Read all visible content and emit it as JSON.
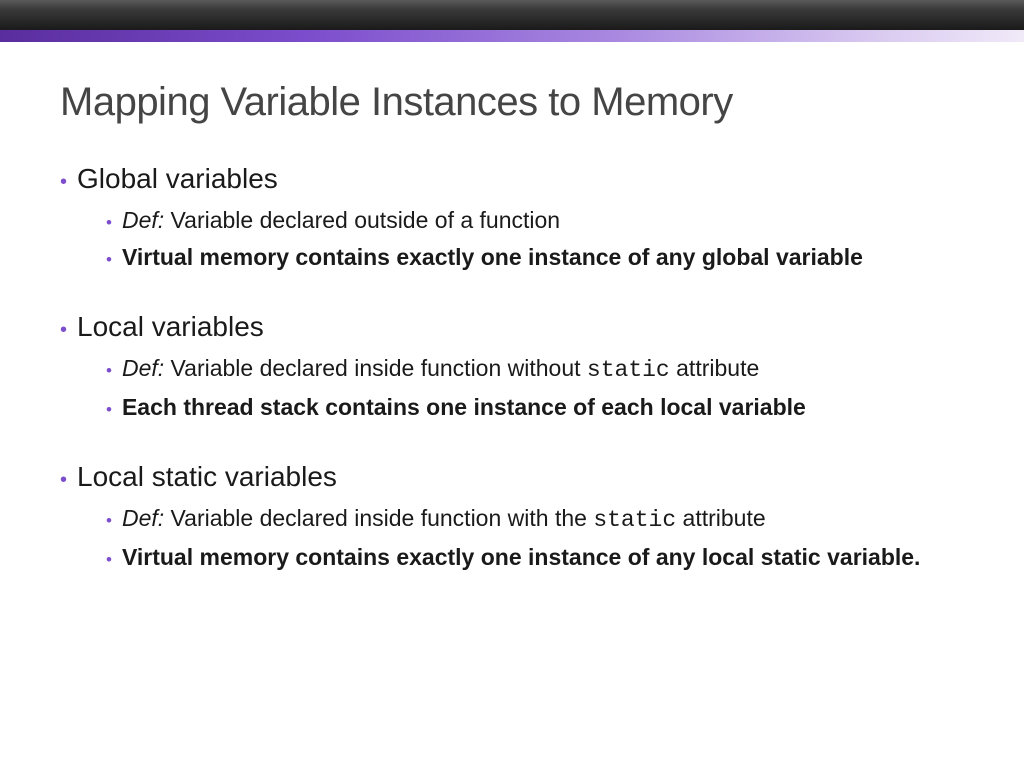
{
  "title": "Mapping Variable Instances to Memory",
  "sections": [
    {
      "heading": "Global variables",
      "items": [
        {
          "def_label": "Def:",
          "def_text": "  Variable declared outside of a function",
          "code": "",
          "suffix": ""
        },
        {
          "emphasis_text": "Virtual memory contains exactly one instance of any global variable"
        }
      ]
    },
    {
      "heading": "Local variables",
      "items": [
        {
          "def_label": "Def:",
          "def_text": " Variable declared inside function without  ",
          "code": "static",
          "suffix": " attribute"
        },
        {
          "emphasis_text": "Each thread stack contains one instance of each local variable"
        }
      ]
    },
    {
      "heading": "Local static variables",
      "items": [
        {
          "def_label": "Def:",
          "def_text": "  Variable declared inside  function with the ",
          "code": "static",
          "suffix": " attribute"
        },
        {
          "emphasis_text": "Virtual memory contains exactly one instance of any local static variable."
        }
      ]
    }
  ]
}
